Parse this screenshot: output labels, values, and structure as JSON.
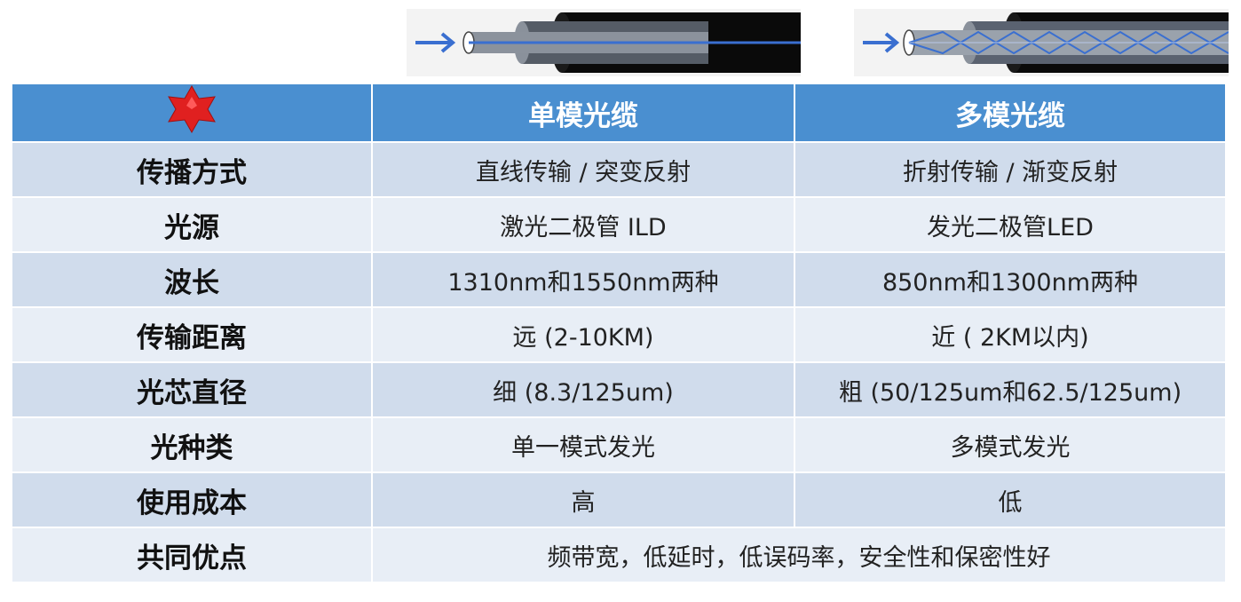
{
  "table": {
    "header": {
      "corner_icon": "red-six-pointed-star-icon",
      "col1": "单模光缆",
      "col2": "多模光缆"
    },
    "rows": [
      {
        "label": "传播方式",
        "single": "直线传输 / 突变反射",
        "multi": "折射传输 / 渐变反射"
      },
      {
        "label": "光源",
        "single": "激光二极管 ILD",
        "multi": "发光二极管LED"
      },
      {
        "label": "波长",
        "single": "1310nm和1550nm两种",
        "multi": "850nm和1300nm两种"
      },
      {
        "label": "传输距离",
        "single": "远 (2-10KM)",
        "multi": "近 ( 2KM以内)"
      },
      {
        "label": "光芯直径",
        "single": "细 (8.3/125um)",
        "multi": "粗 (50/125um和62.5/125um)"
      },
      {
        "label": "光种类",
        "single": "单一模式发光",
        "multi": "多模式发光"
      },
      {
        "label": "使用成本",
        "single": "高",
        "multi": "低"
      }
    ],
    "footer": {
      "label": "共同优点",
      "value": "频带宽，低延时，低误码率，安全性和保密性好"
    }
  },
  "colors": {
    "header_bg": "#4a8fd0",
    "row_dark": "#d0dcec",
    "row_light": "#e8eef6",
    "star": "#e02020"
  },
  "diagrams": {
    "single_mode_icon": "single-mode-fiber-diagram",
    "multi_mode_icon": "multi-mode-fiber-diagram"
  }
}
